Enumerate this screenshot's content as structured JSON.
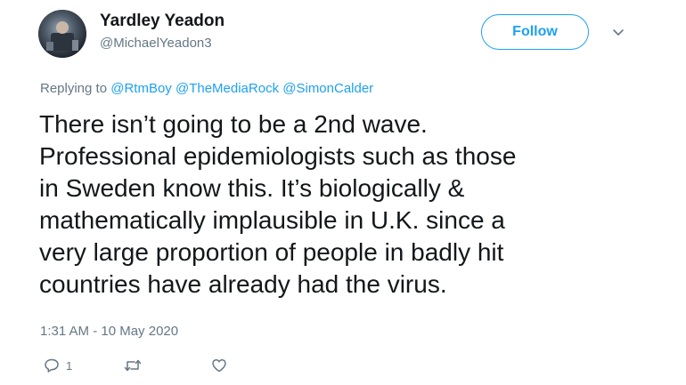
{
  "author": {
    "display_name": "Yardley Yeadon",
    "handle": "@MichaelYeadon3",
    "avatar_icon": "profile-photo"
  },
  "follow_button": {
    "label": "Follow",
    "color": "#1da1f2"
  },
  "more_menu": {
    "icon": "chevron-down-icon"
  },
  "reply_context": {
    "prefix": "Replying to",
    "mentions": [
      "@RtmBoy",
      "@TheMediaRock",
      "@SimonCalder"
    ]
  },
  "tweet": {
    "lines": [
      "There isn’t going to be a 2nd wave.",
      "Professional epidemiologists such as those",
      "in Sweden know this. It’s biologically &",
      "mathematically implausible in U.K. since a",
      "very large proportion of people in badly hit",
      "countries have already had the virus."
    ],
    "timestamp": "1:31 AM - 10 May 2020"
  },
  "actions": {
    "reply": {
      "icon": "reply-icon",
      "count": "1"
    },
    "retweet": {
      "icon": "retweet-icon",
      "count": ""
    },
    "like": {
      "icon": "heart-icon",
      "count": ""
    }
  },
  "colors": {
    "text": "#14171a",
    "secondary_text": "#657786",
    "accent": "#1da1f2"
  }
}
